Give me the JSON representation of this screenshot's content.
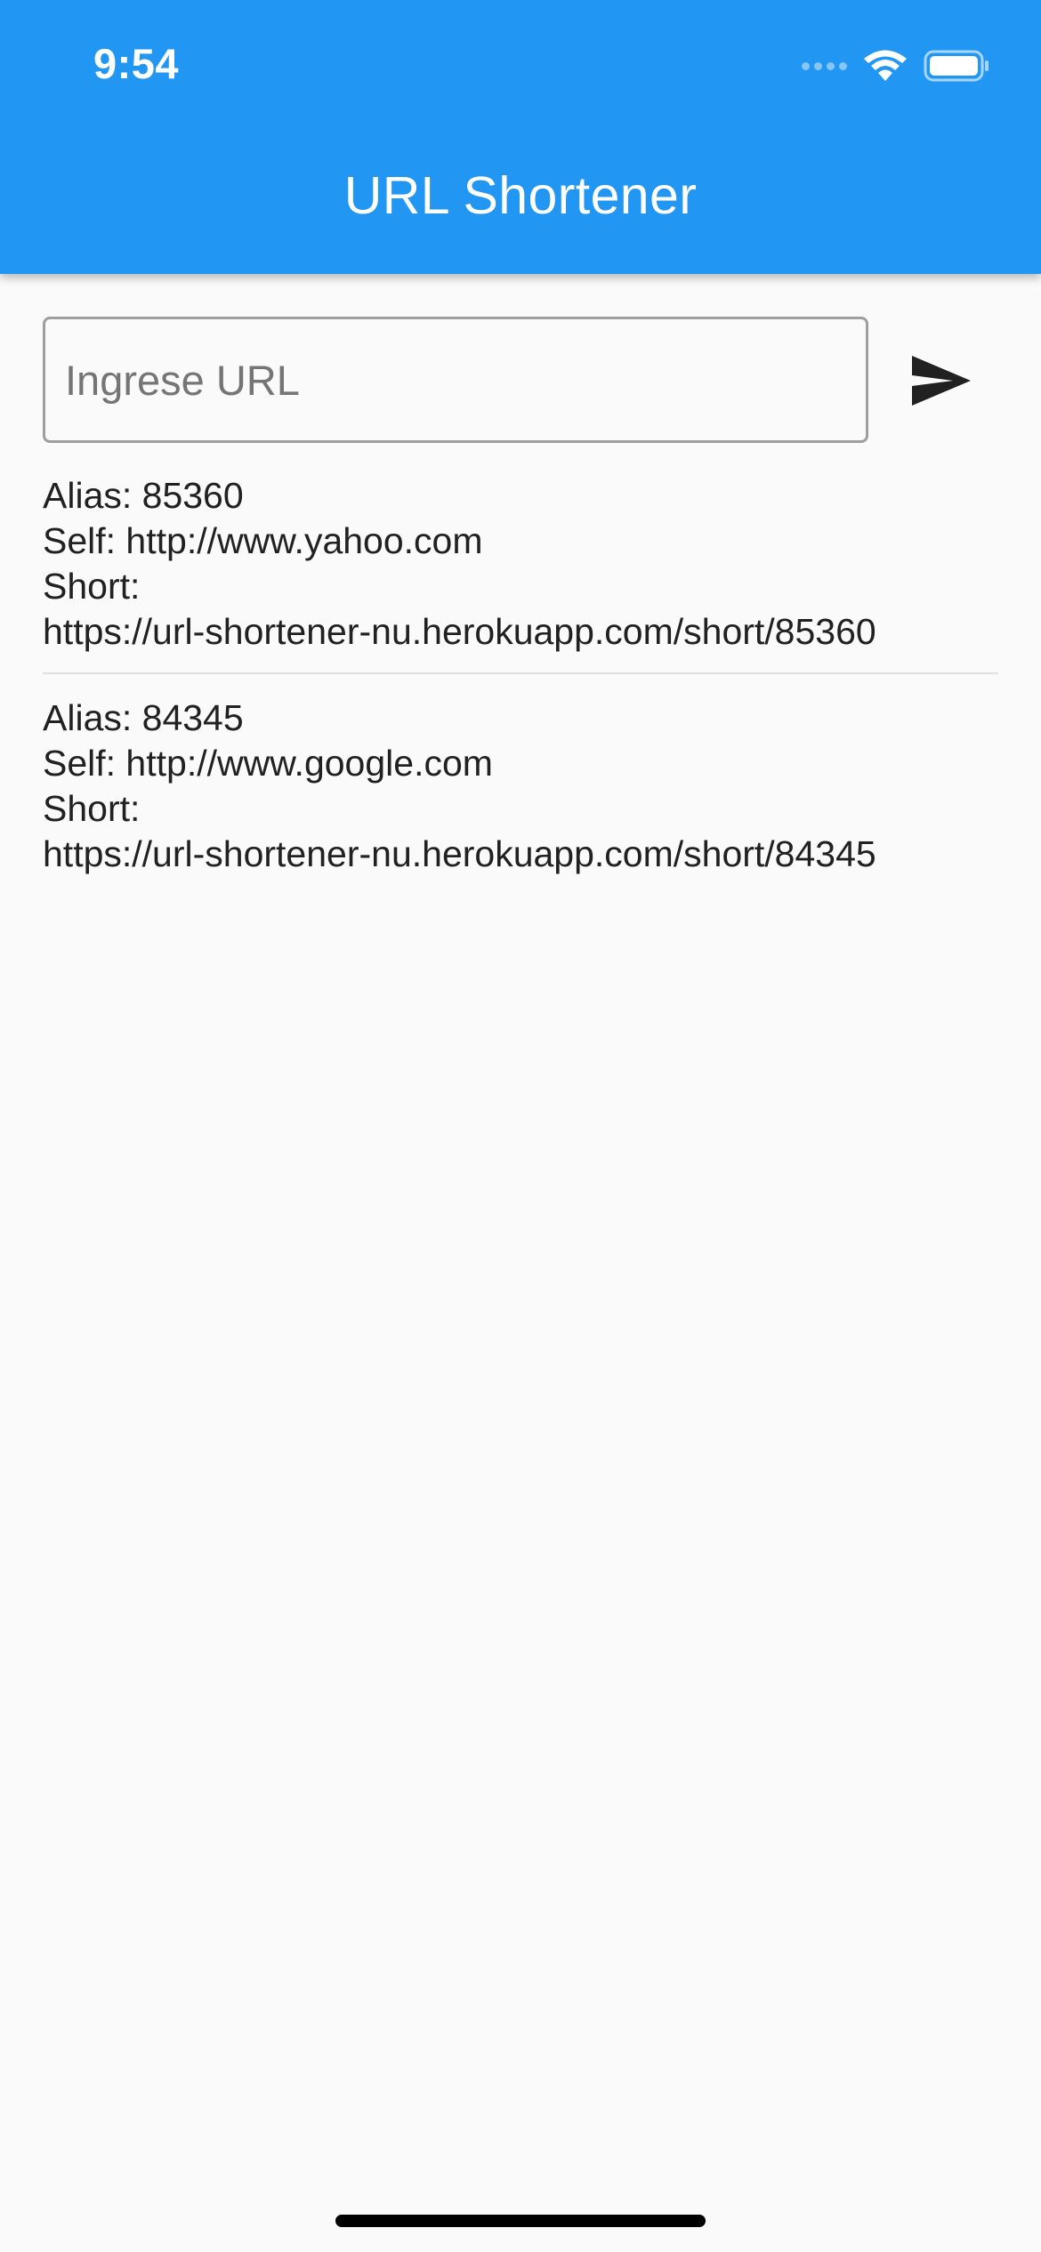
{
  "status_bar": {
    "time": "9:54",
    "icons": [
      "cellular-signal-icon",
      "wifi-icon",
      "battery-icon"
    ]
  },
  "app_bar": {
    "title": "URL Shortener",
    "color": "#2196f3"
  },
  "url_form": {
    "input_value": "",
    "placeholder": "Ingrese URL",
    "submit_icon": "send-icon"
  },
  "links": [
    {
      "alias": "Alias: 85360",
      "self": "Self: http://www.yahoo.com",
      "short_label": "Short:",
      "short_url": "https://url-shortener-nu.herokuapp.com/short/85360"
    },
    {
      "alias": "Alias: 84345",
      "self": "Self: http://www.google.com",
      "short_label": "Short:",
      "short_url": "https://url-shortener-nu.herokuapp.com/short/84345"
    }
  ]
}
